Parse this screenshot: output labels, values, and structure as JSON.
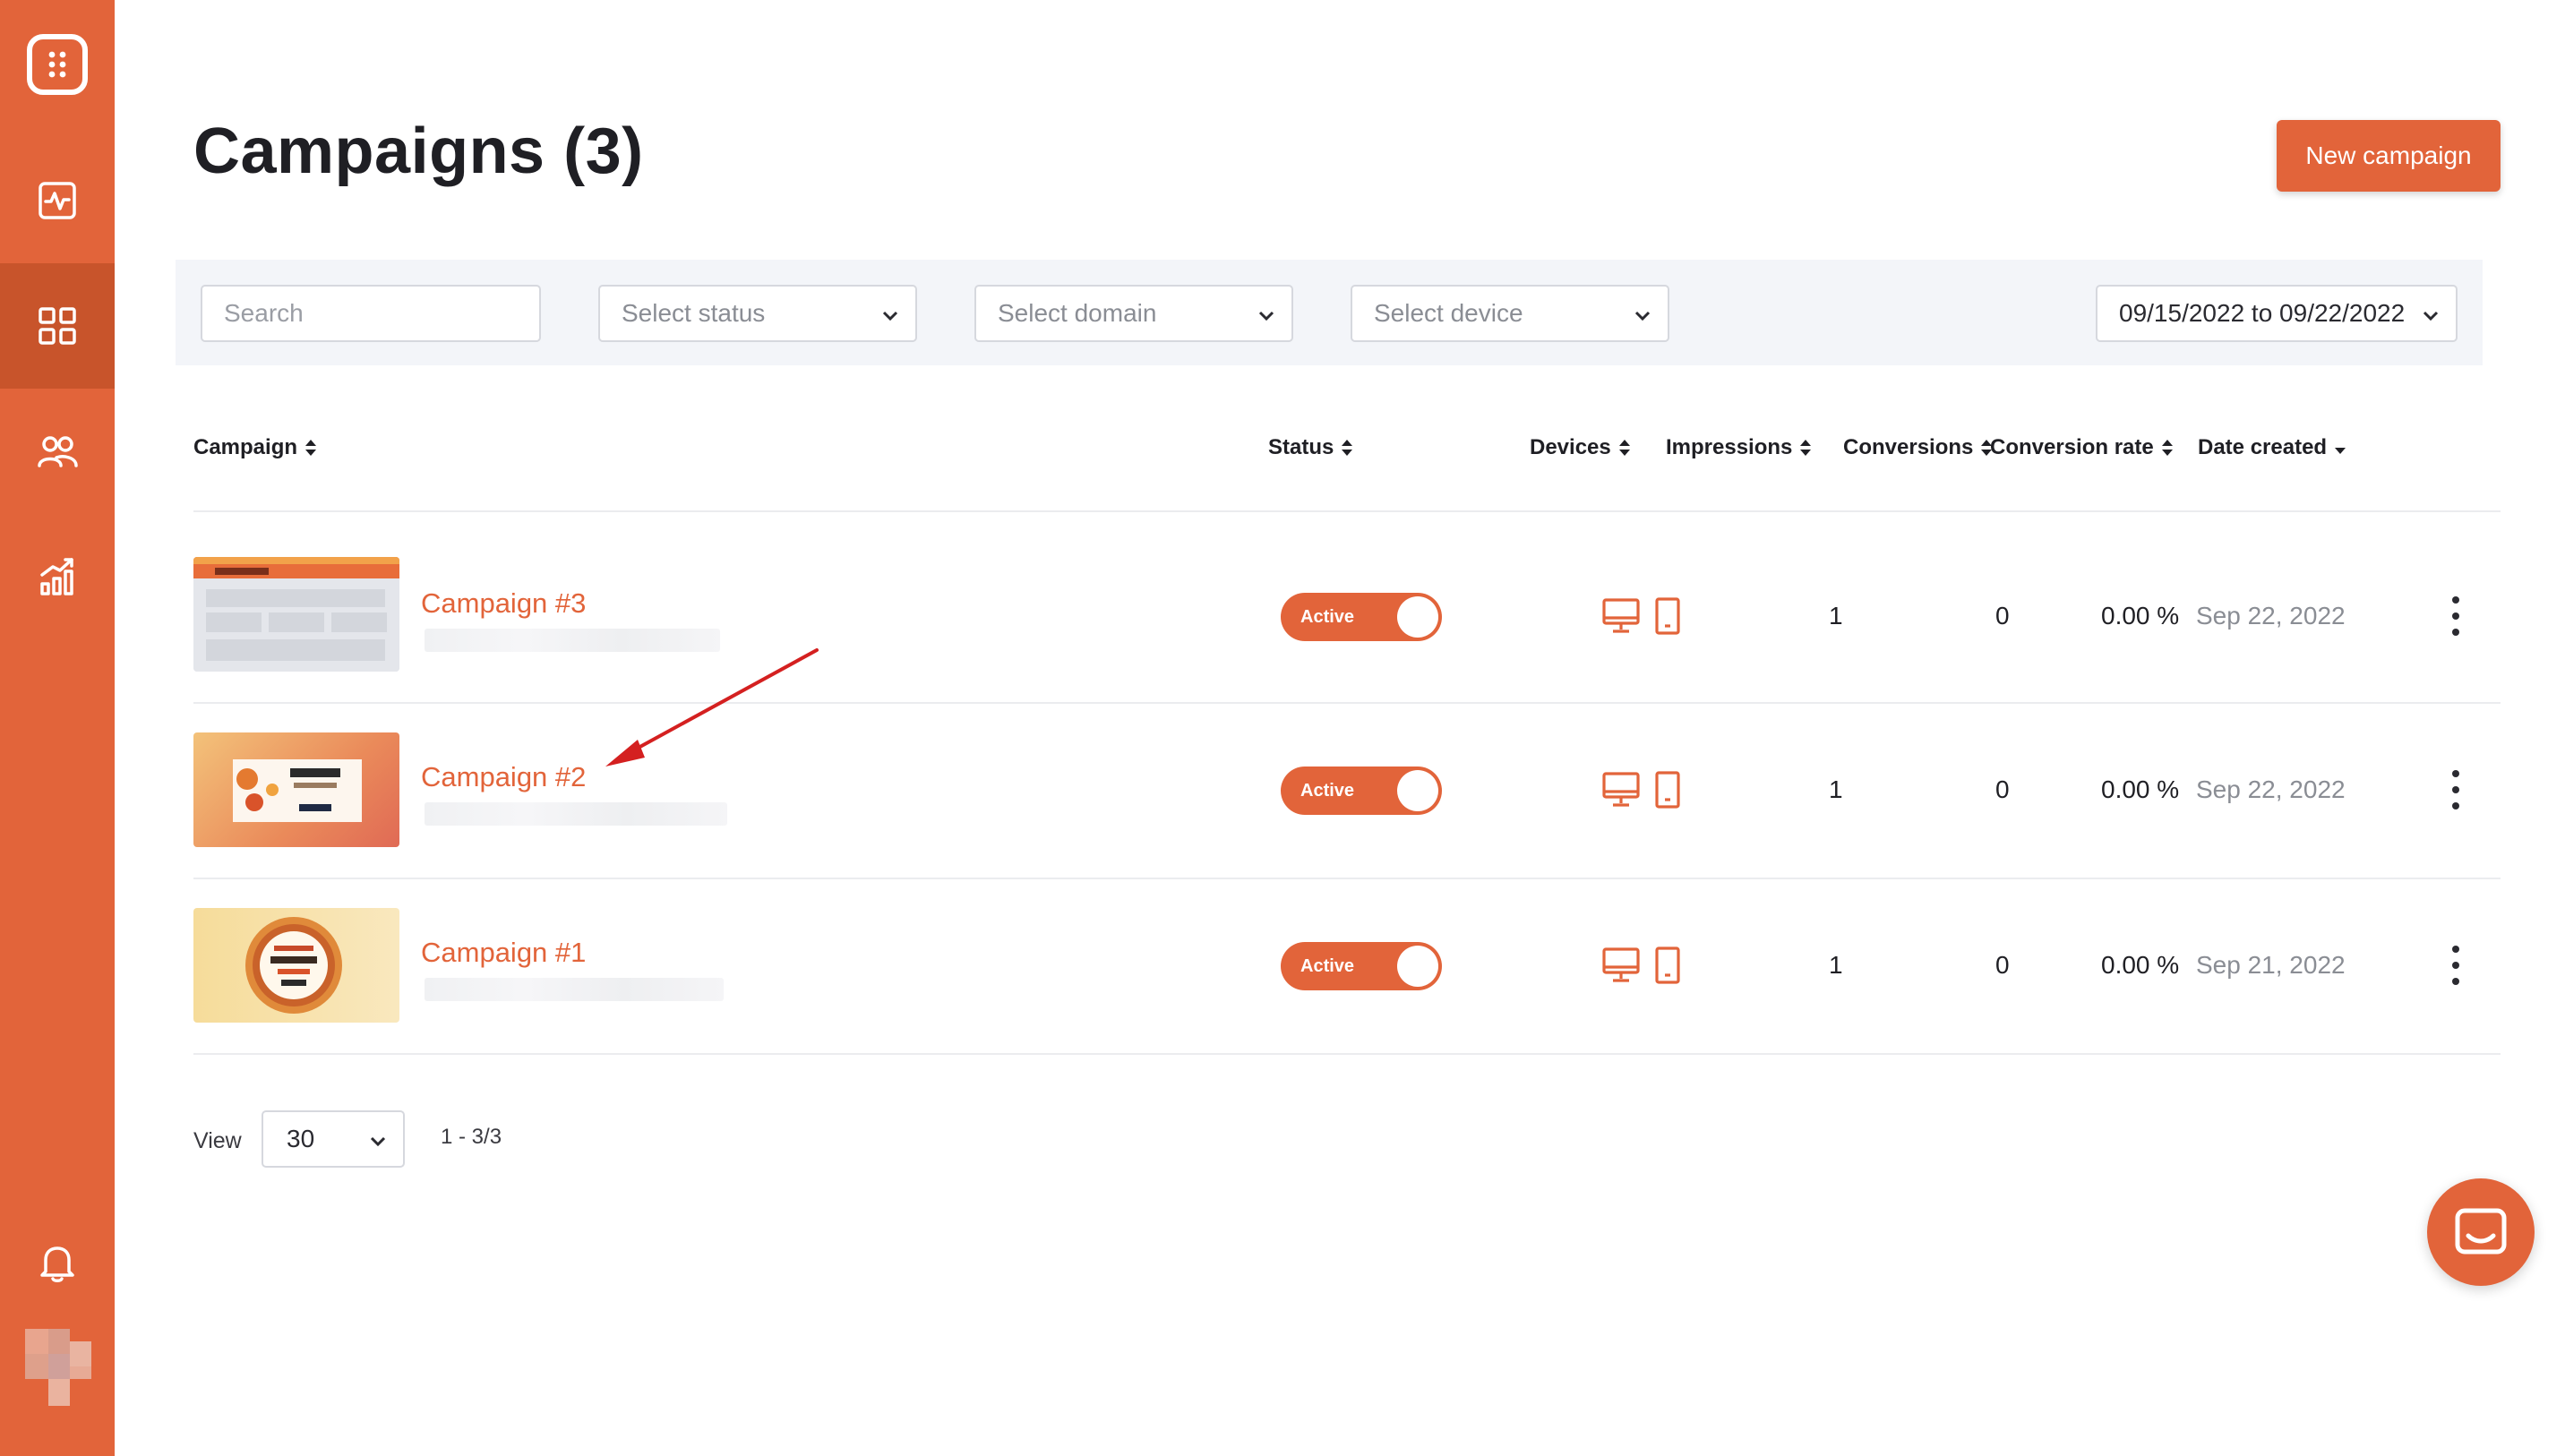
{
  "sidebar": {
    "items": [
      {
        "name": "dashboard",
        "icon": "activity-icon"
      },
      {
        "name": "campaigns",
        "icon": "grid-icon",
        "active": true
      },
      {
        "name": "audience",
        "icon": "users-icon"
      },
      {
        "name": "analytics",
        "icon": "chart-icon"
      }
    ]
  },
  "header": {
    "title": "Campaigns (3)",
    "new_button": "New campaign"
  },
  "filters": {
    "search_placeholder": "Search",
    "status_placeholder": "Select status",
    "domain_placeholder": "Select domain",
    "device_placeholder": "Select device",
    "date_range": "09/15/2022 to 09/22/2022"
  },
  "table": {
    "columns": {
      "campaign": "Campaign",
      "status": "Status",
      "devices": "Devices",
      "impressions": "Impressions",
      "conversions": "Conversions",
      "conversion_rate": "Conversion rate",
      "date_created": "Date created"
    },
    "rows": [
      {
        "name": "Campaign #3",
        "status": "Active",
        "impressions": "1",
        "conversions": "0",
        "rate": "0.00 %",
        "date": "Sep 22, 2022"
      },
      {
        "name": "Campaign #2",
        "status": "Active",
        "impressions": "1",
        "conversions": "0",
        "rate": "0.00 %",
        "date": "Sep 22, 2022"
      },
      {
        "name": "Campaign #1",
        "status": "Active",
        "impressions": "1",
        "conversions": "0",
        "rate": "0.00 %",
        "date": "Sep 21, 2022"
      }
    ]
  },
  "pagination": {
    "view_label": "View",
    "per_page": "30",
    "range": "1 - 3/3"
  },
  "colors": {
    "accent": "#e2643a",
    "sidebar_active": "#c8542b"
  }
}
